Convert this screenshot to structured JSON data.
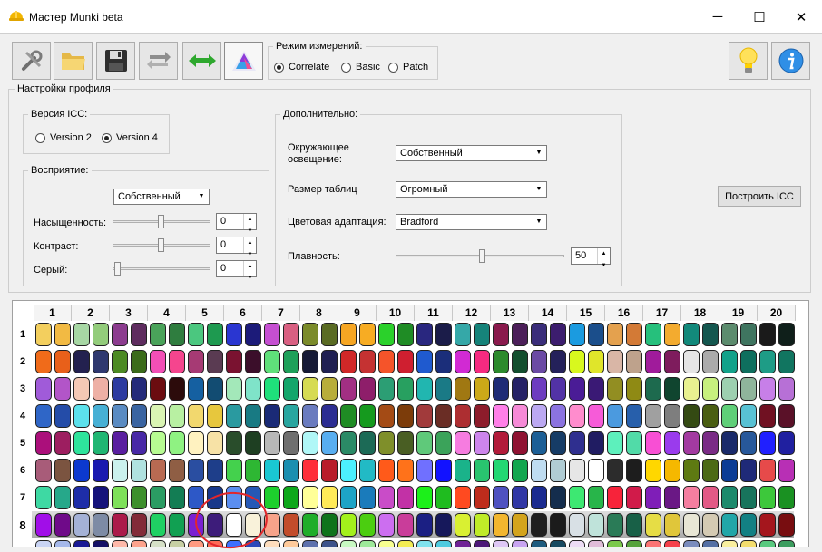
{
  "window": {
    "title": "Мастер Munki beta",
    "minimize_glyph": "─",
    "maximize_glyph": "☐",
    "close_glyph": "✕",
    "icon": "hardhat-icon"
  },
  "toolbar": {
    "buttons": [
      {
        "name": "tools-button",
        "icon": "wrench-icon"
      },
      {
        "name": "open-button",
        "icon": "folder-icon"
      },
      {
        "name": "save-button",
        "icon": "floppy-disk-icon"
      },
      {
        "name": "swap-button",
        "icon": "refresh-arrows-icon"
      },
      {
        "name": "compare-button",
        "icon": "double-arrow-icon"
      },
      {
        "name": "profile-button",
        "icon": "color-triangle-icon",
        "active": true
      }
    ],
    "help_button": "lightbulb-icon",
    "info_button": "info-icon"
  },
  "measure_mode": {
    "title": "Режим измерений:",
    "options": [
      "Correlate",
      "Basic",
      "Patch"
    ],
    "selected": "Correlate"
  },
  "profile": {
    "title": "Настройки профиля",
    "icc_version": {
      "title": "Версия ICC:",
      "options": [
        "Version 2",
        "Version 4"
      ],
      "selected": "Version 4"
    },
    "perception": {
      "title": "Восприятие:",
      "mode": "Собственный",
      "saturation_label": "Насыщенность:",
      "saturation": "0",
      "contrast_label": "Контраст:",
      "contrast": "0",
      "gray_label": "Серый:",
      "gray": "0"
    },
    "extra": {
      "title": "Дополнительно:",
      "ambient_label": "Окружающее\nосвещение:",
      "ambient": "Собственный",
      "table_size_label": "Размер таблиц",
      "table_size": "Огромный",
      "adaptation_label": "Цветовая адаптация:",
      "adaptation": "Bradford",
      "smoothness_label": "Плавность:",
      "smoothness": "50"
    },
    "build_button": "Построить ICC"
  },
  "grid": {
    "columns": [
      "1",
      "2",
      "3",
      "4",
      "5",
      "6",
      "7",
      "8",
      "9",
      "10",
      "11",
      "12",
      "13",
      "14",
      "15",
      "16",
      "17",
      "18",
      "19",
      "20"
    ],
    "rows": [
      "1",
      "2",
      "3",
      "4",
      "5",
      "6",
      "7",
      "8",
      ""
    ],
    "selected_row": "8",
    "patches": [
      [
        "#f3cf5e",
        "#f2ba43",
        "#a7d7a4",
        "#93cc7b",
        "#8c3c8f",
        "#5e2c5f",
        "#4aa35a",
        "#2f7d3f",
        "#4bc77f",
        "#1e9a50",
        "#2a36d1",
        "#1c1b79",
        "#c54fd1",
        "#d96082",
        "#7b8b2a",
        "#5a6b23",
        "#f6a623",
        "#f7ac23",
        "#2bd12b",
        "#1f8c25",
        "#29277f",
        "#1b1c49",
        "#35a8a8",
        "#16837a",
        "#8a1a4d",
        "#4c1f5a",
        "#3a2d7a",
        "#3c1d6e",
        "#1b9be0",
        "#1b4e8b",
        "#e4a14e",
        "#d37a36",
        "#26c07c",
        "#f3ab2f",
        "#12897b",
        "#14574f",
        "#5c8c6e",
        "#3f7560",
        "#1a1a1a",
        "#0f1f1a"
      ],
      [
        "#f06b1a",
        "#e8601a",
        "#23214f",
        "#2f386f",
        "#4c8a23",
        "#3b6b1a",
        "#f24fb6",
        "#f5458e",
        "#a63a74",
        "#5a3b52",
        "#7a1230",
        "#3b0e2a",
        "#5fe07a",
        "#1ea05a",
        "#161a36",
        "#202052",
        "#d02828",
        "#c53232",
        "#f5542a",
        "#cf1f30",
        "#1f5acf",
        "#1b2e7a",
        "#d12ad3",
        "#f52a80",
        "#2c8a2c",
        "#134f2e",
        "#6b4aa4",
        "#24215a",
        "#d8f81e",
        "#e0e52a",
        "#d9b6a6",
        "#bea28c",
        "#a01b9b",
        "#7e1c5d",
        "#e5e5e5",
        "#ababab",
        "#12a28a",
        "#0f6f5e",
        "#1e9c86",
        "#117560"
      ],
      [
        "#a05bd9",
        "#b255c8",
        "#f4c9b5",
        "#eeb0a5",
        "#2c3aa0",
        "#242a7a",
        "#6b0c10",
        "#2c0b0b",
        "#1560a1",
        "#124c72",
        "#a3e8b9",
        "#7fe3c9",
        "#1fe07b",
        "#13a66b",
        "#d6db52",
        "#b8ad3a",
        "#a22f83",
        "#8e1e6a",
        "#2c9e74",
        "#28a060",
        "#21b6b0",
        "#1a7a86",
        "#a07812",
        "#cca918",
        "#1e2b76",
        "#252166",
        "#6d3cc0",
        "#5232a6",
        "#4a1c96",
        "#3a1975",
        "#928e22",
        "#8f8a14",
        "#1d6a4e",
        "#10452f",
        "#e9f190",
        "#c7f07e",
        "#9dd0b0",
        "#8fb59b",
        "#c77fe8",
        "#b770d6"
      ],
      [
        "#2f66c7",
        "#244ca8",
        "#5ce1ec",
        "#47b0d5",
        "#5a8bc2",
        "#3a64a1",
        "#daf5b3",
        "#b8f0a2",
        "#f2d86e",
        "#e7c73d",
        "#2a9aa0",
        "#187a83",
        "#1a2a76",
        "#29a6a0",
        "#6a7bbf",
        "#2c2d92",
        "#1f8c24",
        "#159a1e",
        "#a44b15",
        "#7c3c0a",
        "#a13a3b",
        "#6a2d25",
        "#ad2e31",
        "#8d1c2b",
        "#ff7fe8",
        "#f68ad7",
        "#bba8f2",
        "#8b73e0",
        "#ff8ccd",
        "#f65bd8",
        "#4b9adf",
        "#275fab",
        "#a0a0a0",
        "#7e7e7e",
        "#344a13",
        "#4a5e12",
        "#5fcf78",
        "#58c2d4",
        "#701122",
        "#5a1128"
      ],
      [
        "#ab0f7b",
        "#9d1e60",
        "#2ee49c",
        "#20b673",
        "#5a1ea0",
        "#4828a6",
        "#b7fb92",
        "#8ff282",
        "#fff2c0",
        "#f7e2a6",
        "#294d2b",
        "#1e3f22",
        "#b8b8b8",
        "#6f6f6f",
        "#b0f7f7",
        "#58aef0",
        "#2b8a66",
        "#1c6a56",
        "#7f8f2a",
        "#495e23",
        "#5fc97a",
        "#3ba35a",
        "#f67ce0",
        "#cd85ec",
        "#b21b3a",
        "#8f1232",
        "#1c5f96",
        "#163c66",
        "#2f2f8f",
        "#201c62",
        "#5df0bc",
        "#51dba8",
        "#f84fd4",
        "#9a3bed",
        "#a33aa1",
        "#7a2b86",
        "#1a2a6a",
        "#27589a",
        "#2020ff",
        "#2020a0"
      ],
      [
        "#a85c79",
        "#7b5440",
        "#0c39cf",
        "#1a1ab0",
        "#cbf1ee",
        "#b0e2e0",
        "#b86a52",
        "#8f5e44",
        "#2a4ea1",
        "#1e3e8a",
        "#44d14d",
        "#2eb733",
        "#1ac7d3",
        "#1b8fb0",
        "#ff2f3a",
        "#b91c2a",
        "#4cf0ff",
        "#22bac5",
        "#ff5a1a",
        "#ff721a",
        "#7070ff",
        "#1212ff",
        "#1ab38a",
        "#29c56f",
        "#23d773",
        "#13a64f",
        "#bfdcf1",
        "#b0ccd4",
        "#e6e6e6",
        "#ffffff",
        "#2c2c2c",
        "#1d1d1d",
        "#ffd700",
        "#f5b800",
        "#5e7a12",
        "#4c6a15",
        "#0b3c95",
        "#1f2a78",
        "#e64a4a",
        "#b82fb5"
      ],
      [
        "#3ed9a3",
        "#26a88a",
        "#1e2da8",
        "#15137b",
        "#7ee05a",
        "#3d8f2c",
        "#2b9c63",
        "#137d54",
        "#2d58c7",
        "#18388a",
        "#5b8ef0",
        "#2658b5",
        "#1dcf2d",
        "#0ea81b",
        "#ffff98",
        "#ffea58",
        "#1da4c6",
        "#1a7bbb",
        "#c94cc8",
        "#c231a6",
        "#1cf01a",
        "#1fbc1f",
        "#ff4a20",
        "#be2c1c",
        "#4f51c0",
        "#3137a5",
        "#1a2a8f",
        "#142d4d",
        "#3de872",
        "#28b54a",
        "#f7233a",
        "#d11b4a",
        "#7f1eb8",
        "#6a1885",
        "#f57ea0",
        "#e25a86",
        "#1c8a6c",
        "#18745c",
        "#3dc83b",
        "#1a9122"
      ],
      [
        "#a10ee8",
        "#6f0a89",
        "#a4b1d6",
        "#7d8ba5",
        "#ab1a4a",
        "#822a38",
        "#1fd063",
        "#11a052",
        "#7a1fd1",
        "#3d1c7a",
        "#ffffff",
        "#f9f2da",
        "#f7a38a",
        "#c24c2b",
        "#1fad2a",
        "#0e731b",
        "#a3f11b",
        "#4bce10",
        "#cc6ef0",
        "#c93d9a",
        "#1b1f83",
        "#16185b",
        "#d9f032",
        "#bfeb28",
        "#f2b62f",
        "#d3a41d",
        "#1f1f1f",
        "#1b1b1b",
        "#d8e0e5",
        "#bfe3da",
        "#2a7b57",
        "#186047",
        "#e6dd45",
        "#e0c63a",
        "#e8e6d5",
        "#d4cab3",
        "#21a6a8",
        "#128083",
        "#a4161d",
        "#780d10"
      ],
      [
        "#c9d4f4",
        "#a5b8ea",
        "#1a1a95",
        "#141066",
        "#fdb8a9",
        "#fda38d",
        "#d6e0c7",
        "#c7cfa3",
        "#ff9a80",
        "#ff6a55",
        "#3c70ff",
        "#2b48ba",
        "#feddbd",
        "#ffca9a",
        "#5d71ad",
        "#3d538a",
        "#c8f9c2",
        "#9ee99a",
        "#f8ff8f",
        "#f3ec52",
        "#7fe2ed",
        "#4fcbe0",
        "#6f2295",
        "#4c1877",
        "#dec7f5",
        "#c8a4f0",
        "#1e5b7e",
        "#174a60",
        "#ecdcf4",
        "#e0bcd8",
        "#7bc94b",
        "#56a23a",
        "#fb7373",
        "#f5404a",
        "#7a8cbd",
        "#546fa4",
        "#f9ef9e",
        "#f3dd6e",
        "#58c97e",
        "#3b9c5e"
      ]
    ]
  }
}
